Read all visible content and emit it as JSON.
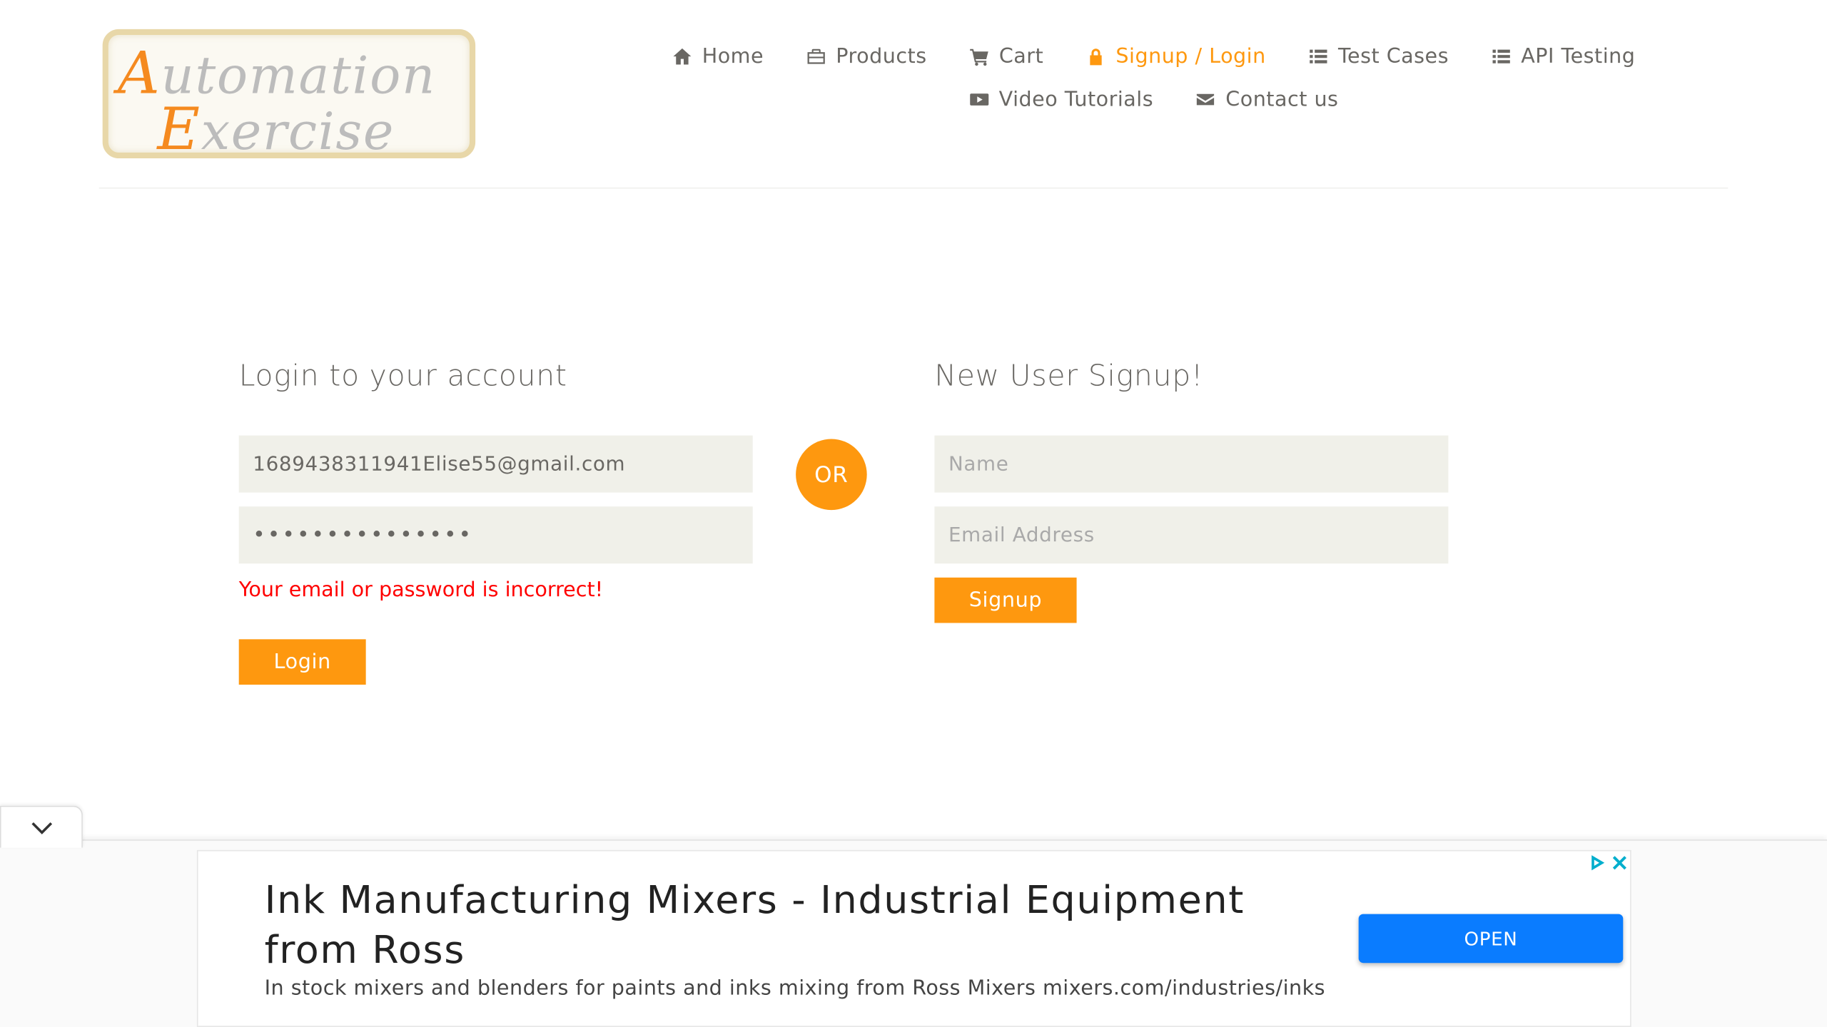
{
  "logo": {
    "line1_cap": "A",
    "line1_rest": "utomation",
    "line2_cap": "E",
    "line2_rest": "xercise",
    "accent_color": "#f58a1f"
  },
  "nav": {
    "items": [
      {
        "label": "Home",
        "icon": "home-icon"
      },
      {
        "label": "Products",
        "icon": "briefcase-icon"
      },
      {
        "label": "Cart",
        "icon": "cart-icon"
      },
      {
        "label": "Signup / Login",
        "icon": "lock-icon",
        "active": true
      },
      {
        "label": "Test Cases",
        "icon": "list-icon"
      },
      {
        "label": "API Testing",
        "icon": "list-icon"
      },
      {
        "label": "Video Tutorials",
        "icon": "youtube-play-icon"
      },
      {
        "label": "Contact us",
        "icon": "envelope-icon"
      }
    ],
    "active_color": "#fe980f"
  },
  "login": {
    "title": "Login to your account",
    "email_value": "1689438311941Elise55@gmail.com",
    "password_masked": "•••••••••••••••",
    "error": "Your email or password is incorrect!",
    "button": "Login"
  },
  "divider": {
    "label": "OR"
  },
  "signup": {
    "title": "New User Signup!",
    "name_placeholder": "Name",
    "email_placeholder": "Email Address",
    "button": "Signup"
  },
  "ad": {
    "headline": "Ink Manufacturing Mixers - Industrial Equipment from Ross",
    "description": "In stock mixers and blenders for paints and inks mixing from Ross Mixers mixers.com/industries/inks",
    "button": "OPEN",
    "button_color": "#0a7cff"
  },
  "colors": {
    "accent": "#fe980f",
    "error": "#ff0000",
    "field_bg": "#f0f0e9",
    "text": "#696763"
  }
}
